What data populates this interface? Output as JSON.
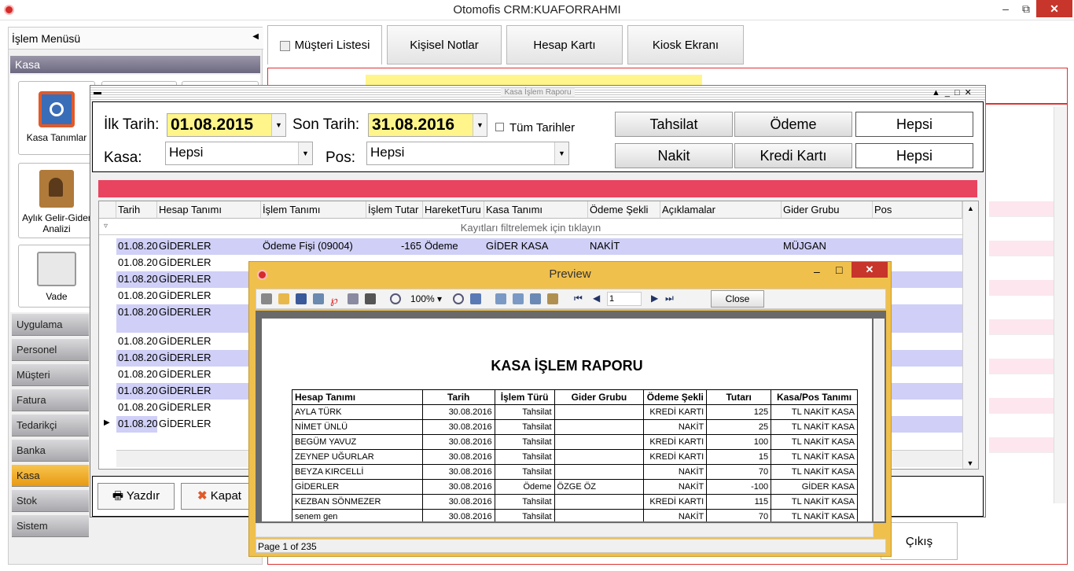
{
  "window": {
    "title": "Otomofis CRM:KUAFORRAHMI"
  },
  "sidebar": {
    "title": "İşlem Menüsü",
    "section": "Kasa",
    "tiles": [
      {
        "label": "Kasa Tanımlar"
      },
      {
        "label": "Aylık Gelir-Gider Analizi"
      },
      {
        "label": "Vade"
      }
    ],
    "nav": [
      "Uygulama",
      "Personel",
      "Müşteri",
      "Fatura",
      "Tedarikçi",
      "Banka",
      "Kasa",
      "Stok",
      "Sistem"
    ],
    "active": "Kasa"
  },
  "tabs": [
    {
      "label": "Müşteri Listesi"
    },
    {
      "label": "Kişisel Notlar"
    },
    {
      "label": "Hesap Kartı"
    },
    {
      "label": "Kiosk Ekranı"
    }
  ],
  "report": {
    "window_title": "Kasa İşlem Raporu",
    "ilk_tarih_label": "İlk Tarih:",
    "ilk_tarih": "01.08.2015",
    "son_tarih_label": "Son Tarih:",
    "son_tarih": "31.08.2016",
    "tum_tarihler": "Tüm Tarihler",
    "kasa_label": "Kasa:",
    "kasa": "Hepsi",
    "pos_label": "Pos:",
    "pos": "Hepsi",
    "btn_tahsilat": "Tahsilat",
    "btn_odeme": "Ödeme",
    "btn_hepsi1": "Hepsi",
    "btn_nakit": "Nakit",
    "btn_kredi": "Kredi Kartı",
    "btn_hepsi2": "Hepsi",
    "filter_hint": "Kayıtları filtrelemek için tıklayın",
    "btn_yazdir": "Yazdır",
    "btn_kapat": "Kapat",
    "columns": [
      "Tarih",
      "Hesap Tanımı",
      "İşlem Tanımı",
      "İşlem Tutar",
      "HareketTuru",
      "Kasa Tanımı",
      "Ödeme Şekli",
      "Açıklamalar",
      "Gider Grubu",
      "Pos"
    ],
    "rows": [
      {
        "tarih": "01.08.20",
        "hesap": "GİDERLER",
        "islem": "Ödeme Fişi (09004)",
        "tutar": "-165",
        "hareket": "Ödeme",
        "kasa": "GİDER KASA",
        "odeme": "NAKİT",
        "aciklama": "",
        "gider": "MÜJGAN"
      },
      {
        "tarih": "01.08.20",
        "hesap": "GİDERLER",
        "islem": "",
        "tutar": "",
        "hareket": "",
        "kasa": "",
        "odeme": "",
        "aciklama": "",
        "gider": ""
      },
      {
        "tarih": "01.08.20",
        "hesap": "GİDERLER",
        "islem": "",
        "tutar": "",
        "hareket": "",
        "kasa": "",
        "odeme": "",
        "aciklama": "",
        "gider": ""
      },
      {
        "tarih": "01.08.20",
        "hesap": "GİDERLER",
        "islem": "",
        "tutar": "",
        "hareket": "",
        "kasa": "",
        "odeme": "",
        "aciklama": "",
        "gider": ""
      },
      {
        "tarih": "01.08.20",
        "hesap": "GİDERLER",
        "islem": "",
        "tutar": "",
        "hareket": "",
        "kasa": "",
        "odeme": "",
        "aciklama": "",
        "gider": ""
      },
      {
        "tarih": "01.08.20",
        "hesap": "GİDERLER",
        "islem": "",
        "tutar": "",
        "hareket": "",
        "kasa": "",
        "odeme": "",
        "aciklama": "",
        "gider": ""
      },
      {
        "tarih": "01.08.20",
        "hesap": "GİDERLER",
        "islem": "",
        "tutar": "",
        "hareket": "",
        "kasa": "",
        "odeme": "",
        "aciklama": "",
        "gider": ""
      },
      {
        "tarih": "01.08.20",
        "hesap": "GİDERLER",
        "islem": "",
        "tutar": "",
        "hareket": "",
        "kasa": "",
        "odeme": "",
        "aciklama": "",
        "gider": ""
      },
      {
        "tarih": "01.08.20",
        "hesap": "GİDERLER",
        "islem": "",
        "tutar": "",
        "hareket": "",
        "kasa": "",
        "odeme": "",
        "aciklama": "",
        "gider": ""
      },
      {
        "tarih": "01.08.20",
        "hesap": "GİDERLER",
        "islem": "",
        "tutar": "",
        "hareket": "",
        "kasa": "",
        "odeme": "",
        "aciklama": "",
        "gider": ""
      },
      {
        "tarih": "01.08.20",
        "hesap": "GİDERLER",
        "islem": "",
        "tutar": "",
        "hareket": "",
        "kasa": "",
        "odeme": "",
        "aciklama": "",
        "gider": ""
      }
    ]
  },
  "preview": {
    "title": "Preview",
    "zoom": "100%",
    "page_input": "1",
    "close_label": "Close",
    "report_title": "KASA İŞLEM RAPORU",
    "status": "Page 1 of 235",
    "columns": [
      "Hesap Tanımı",
      "Tarih",
      "İşlem Türü",
      "Gider Grubu",
      "Ödeme Şekli",
      "Tutarı",
      "Kasa/Pos Tanımı"
    ],
    "rows": [
      [
        "AYLA TÜRK",
        "30.08.2016",
        "Tahsilat",
        "",
        "KREDİ KARTI",
        "125",
        "TL NAKİT KASA"
      ],
      [
        "NİMET ÜNLÜ",
        "30.08.2016",
        "Tahsilat",
        "",
        "NAKİT",
        "25",
        "TL NAKİT KASA"
      ],
      [
        "BEGÜM YAVUZ",
        "30.08.2016",
        "Tahsilat",
        "",
        "KREDİ KARTI",
        "100",
        "TL NAKİT KASA"
      ],
      [
        "ZEYNEP UĞURLAR",
        "30.08.2016",
        "Tahsilat",
        "",
        "KREDİ KARTI",
        "15",
        "TL NAKİT KASA"
      ],
      [
        "BEYZA KIRCELLİ",
        "30.08.2016",
        "Tahsilat",
        "",
        "NAKİT",
        "70",
        "TL NAKİT KASA"
      ],
      [
        "GİDERLER",
        "30.08.2016",
        "Ödeme",
        "ÖZGE ÖZ",
        "NAKİT",
        "-100",
        "GİDER KASA"
      ],
      [
        "KEZBAN SÖNMEZER",
        "30.08.2016",
        "Tahsilat",
        "",
        "KREDİ KARTI",
        "115",
        "TL NAKİT KASA"
      ],
      [
        "senem gen",
        "30.08.2016",
        "Tahsilat",
        "",
        "NAKİT",
        "70",
        "TL NAKİT KASA"
      ]
    ]
  },
  "footer": {
    "exit_label": "Çıkış"
  }
}
